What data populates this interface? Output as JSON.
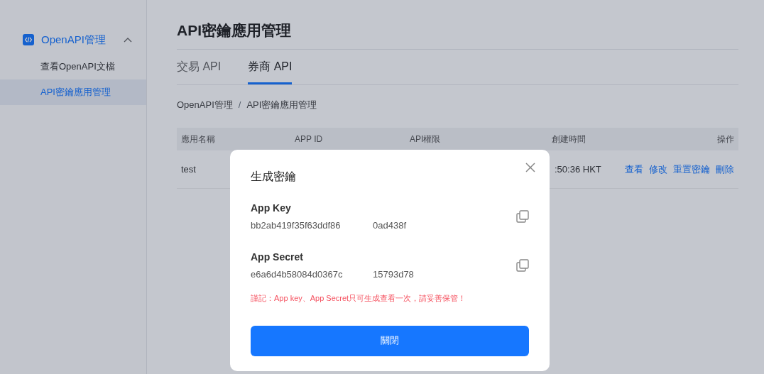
{
  "sidebar": {
    "group": {
      "label": "OpenAPI管理",
      "expanded": true,
      "children": [
        {
          "label": "查看OpenAPI文檔",
          "selected": false
        },
        {
          "label": "API密鑰應用管理",
          "selected": true
        }
      ]
    }
  },
  "page_title": "API密鑰應用管理",
  "tabs": [
    {
      "label": "交易 API",
      "selected": false
    },
    {
      "label": "券商 API",
      "selected": true
    }
  ],
  "breadcrumb": {
    "separator": "/",
    "items": [
      "OpenAPI管理",
      "API密鑰應用管理"
    ]
  },
  "table": {
    "columns": [
      "應用名稱",
      "APP ID",
      "API權限",
      "創建時間",
      "操作"
    ],
    "rows": [
      {
        "name": "test",
        "created": ":50:36 HKT",
        "actions": [
          "查看",
          "修改",
          "重置密鑰",
          "刪除"
        ]
      }
    ]
  },
  "modal": {
    "title": "生成密鑰",
    "fields": [
      {
        "label": "App Key",
        "value_start": "bb2ab419f35f63ddf86",
        "value_end": "0ad438f"
      },
      {
        "label": "App Secret",
        "value_start": "e6a6d4b58084d0367c",
        "value_end": "15793d78"
      }
    ],
    "warning": "謹記：App key、App Secret只可生成查看一次，請妥善保管！",
    "button": "關閉"
  }
}
